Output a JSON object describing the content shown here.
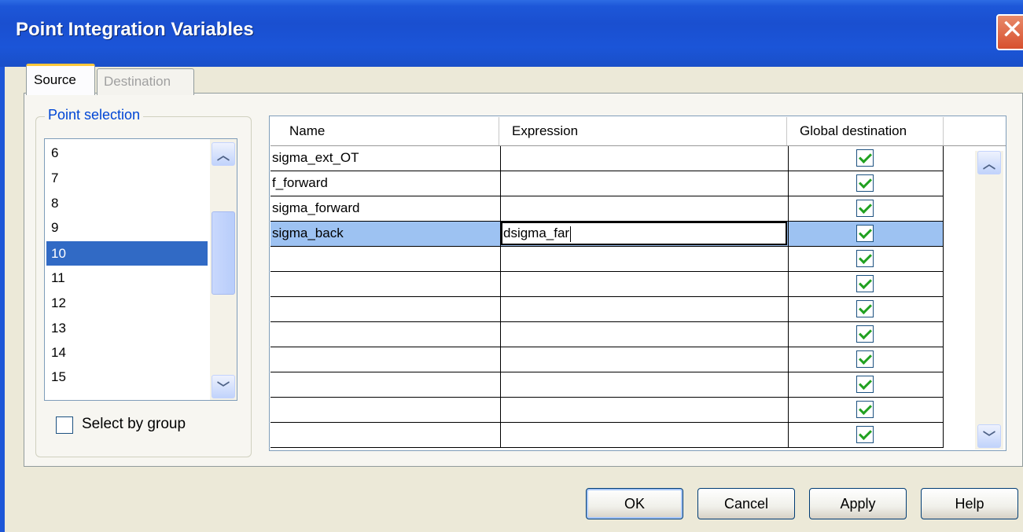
{
  "window": {
    "title": "Point Integration Variables"
  },
  "tabs": [
    {
      "label": "Source",
      "active": true
    },
    {
      "label": "Destination",
      "active": false
    }
  ],
  "point_selection": {
    "label": "Point selection",
    "items": [
      "6",
      "7",
      "8",
      "9",
      "10",
      "11",
      "12",
      "13",
      "14",
      "15"
    ],
    "selected": "10",
    "select_by_group_label": "Select by group",
    "select_by_group_checked": false
  },
  "grid": {
    "columns": [
      "Name",
      "Expression",
      "Global destination"
    ],
    "rows": [
      {
        "name": "sigma_ext_OT",
        "expression": "",
        "global": true
      },
      {
        "name": "f_forward",
        "expression": "",
        "global": true
      },
      {
        "name": "sigma_forward",
        "expression": "",
        "global": true
      },
      {
        "name": "sigma_back",
        "expression": "dsigma_far",
        "global": true,
        "selected": true,
        "editing": true
      },
      {
        "name": "",
        "expression": "",
        "global": true
      },
      {
        "name": "",
        "expression": "",
        "global": true
      },
      {
        "name": "",
        "expression": "",
        "global": true
      },
      {
        "name": "",
        "expression": "",
        "global": true
      },
      {
        "name": "",
        "expression": "",
        "global": true
      },
      {
        "name": "",
        "expression": "",
        "global": true
      },
      {
        "name": "",
        "expression": "",
        "global": true
      },
      {
        "name": "",
        "expression": "",
        "global": true
      }
    ]
  },
  "buttons": {
    "ok": "OK",
    "cancel": "Cancel",
    "apply": "Apply",
    "help": "Help"
  },
  "icons": {
    "close": "close-icon",
    "scroll_up": "chevron-up-icon",
    "scroll_down": "chevron-down-icon"
  }
}
